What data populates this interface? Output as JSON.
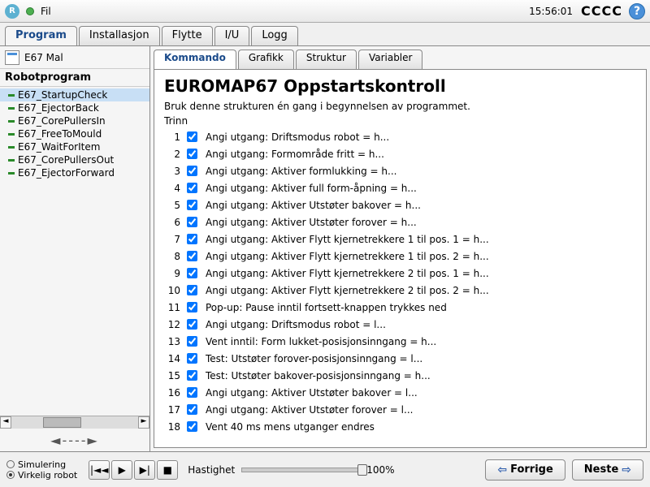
{
  "topbar": {
    "menu_file": "Fil",
    "clock": "15:56:01",
    "cccc": "CCCC"
  },
  "main_tabs": [
    "Program",
    "Installasjon",
    "Flytte",
    "I/U",
    "Logg"
  ],
  "file_name": "E67 Mal",
  "tree_header": "Robotprogram",
  "tree_items": [
    "E67_StartupCheck",
    "E67_EjectorBack",
    "E67_CorePullersIn",
    "E67_FreeToMould",
    "E67_WaitForItem",
    "E67_CorePullersOut",
    "E67_EjectorForward"
  ],
  "sub_tabs": [
    "Kommando",
    "Grafikk",
    "Struktur",
    "Variabler"
  ],
  "heading": "EUROMAP67 Oppstartskontroll",
  "description": "Bruk denne strukturen én gang i begynnelsen av programmet.",
  "group_label": "Trinn",
  "steps": [
    "Angi utgang: Driftsmodus robot = h...",
    "Angi utgang: Formområde fritt = h...",
    "Angi utgang: Aktiver formlukking = h...",
    "Angi utgang: Aktiver full form-åpning = h...",
    "Angi utgang: Aktiver Utstøter bakover = h...",
    "Angi utgang: Aktiver Utstøter forover = h...",
    "Angi utgang: Aktiver Flytt kjernetrekkere 1 til pos. 1 = h...",
    "Angi utgang: Aktiver Flytt kjernetrekkere 1 til pos. 2 = h...",
    "Angi utgang: Aktiver Flytt kjernetrekkere 2 til pos. 1 = h...",
    "Angi utgang: Aktiver Flytt kjernetrekkere 2 til pos. 2 = h...",
    "Pop-up: Pause inntil fortsett-knappen trykkes ned",
    "Angi utgang: Driftsmodus robot = l...",
    "Vent inntil: Form lukket-posisjonsinngang = h...",
    "Test: Utstøter forover-posisjonsinngang = l...",
    "Test: Utstøter bakover-posisjonsinngang = h...",
    "Angi utgang: Aktiver Utstøter bakover = l...",
    "Angi utgang: Aktiver Utstøter forover = l...",
    "Vent 40 ms mens utganger endres"
  ],
  "bottom": {
    "mode_sim": "Simulering",
    "mode_real": "Virkelig robot",
    "speed_label": "Hastighet",
    "speed_pct": "100%",
    "prev": "Forrige",
    "next": "Neste"
  }
}
